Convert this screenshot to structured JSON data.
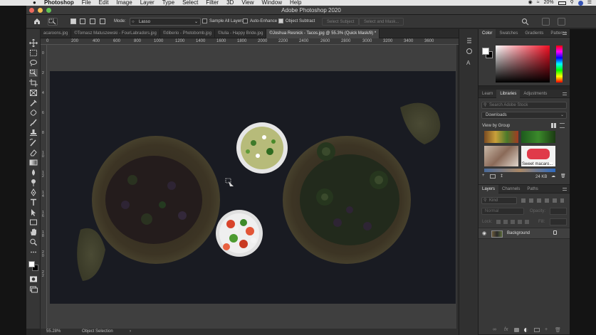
{
  "menubar": {
    "app": "Photoshop",
    "items": [
      "File",
      "Edit",
      "Image",
      "Layer",
      "Type",
      "Select",
      "Filter",
      "3D",
      "View",
      "Window",
      "Help"
    ],
    "battery": "20%"
  },
  "window": {
    "title": "Adobe Photoshop 2020"
  },
  "options": {
    "mode_label": "Mode:",
    "mode_value": "Lasso",
    "sample_all_layers": "Sample All Layers",
    "auto_enhance": "Auto-Enhance",
    "object_subtract": "Object Subtract",
    "select_subject": "Select Subject",
    "select_and_mask": "Select and Mask..."
  },
  "tabs": [
    {
      "label": "acaroons.jpg",
      "active": false
    },
    {
      "label": "©Tomasz Matuszewski - FourLabradors.jpg",
      "active": false
    },
    {
      "label": "©diberio - Photobomb.jpg",
      "active": false
    },
    {
      "label": "©Iulia - Happy Bride.jpg",
      "active": false
    },
    {
      "label": "©Joshua Resnick - Tacos.jpg @ 55.3% (Quick Mask/8) *",
      "active": true
    }
  ],
  "ruler_top": [
    "0",
    "200",
    "400",
    "600",
    "800",
    "1000",
    "1200",
    "1400",
    "1600",
    "1800",
    "2000",
    "2200",
    "2400",
    "2600",
    "2800",
    "3000",
    "3200",
    "3400",
    "3600"
  ],
  "ruler_left": [
    "0",
    "2",
    "4",
    "6",
    "8",
    "10",
    "12",
    "14",
    "16",
    "18",
    "20",
    "22"
  ],
  "status": {
    "zoom": "55.28%",
    "tool": "Object Selection",
    "arrow": "›"
  },
  "color_panel": {
    "tabs": [
      "Color",
      "Swatches",
      "Gradients",
      "Patterns"
    ]
  },
  "libraries_panel": {
    "tabs": [
      "Learn",
      "Libraries",
      "Adjustments"
    ],
    "search_placeholder": "Search Adobe Stock",
    "library": "Downloads",
    "view_by": "View by Group",
    "thumb_label": "Sweet macaro...",
    "size": "24 KB"
  },
  "layers_panel": {
    "tabs": [
      "Layers",
      "Channels",
      "Paths"
    ],
    "kind_placeholder": "Kind",
    "blend_mode": "Normal",
    "opacity_label": "Opacity:",
    "lock_label": "Lock:",
    "fill_label": "Fill:",
    "layer_name": "Background"
  },
  "colors": {
    "accent_blue": "#2d8ceb",
    "quick_mask": "#000000"
  }
}
